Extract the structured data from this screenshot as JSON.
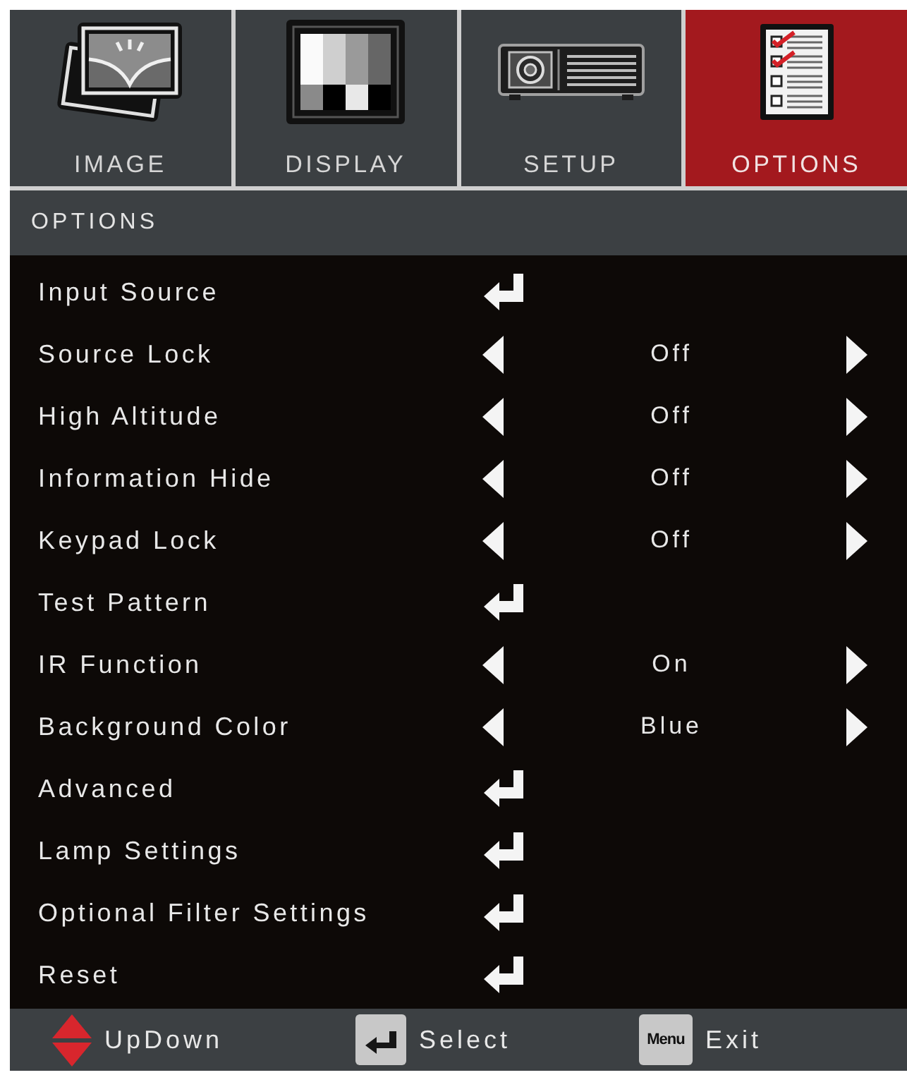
{
  "tabs": [
    {
      "label": "IMAGE",
      "kind": "image",
      "selected": false
    },
    {
      "label": "DISPLAY",
      "kind": "display",
      "selected": false
    },
    {
      "label": "SETUP",
      "kind": "setup",
      "selected": false
    },
    {
      "label": "OPTIONS",
      "kind": "options",
      "selected": true
    }
  ],
  "section_title": "OPTIONS",
  "items": [
    {
      "label": "Input Source",
      "kind": "submenu"
    },
    {
      "label": "Source Lock",
      "kind": "choice",
      "value": "Off"
    },
    {
      "label": "High Altitude",
      "kind": "choice",
      "value": "Off"
    },
    {
      "label": "Information Hide",
      "kind": "choice",
      "value": "Off"
    },
    {
      "label": "Keypad Lock",
      "kind": "choice",
      "value": "Off"
    },
    {
      "label": "Test Pattern",
      "kind": "submenu"
    },
    {
      "label": "IR Function",
      "kind": "choice",
      "value": "On"
    },
    {
      "label": "Background Color",
      "kind": "choice",
      "value": "Blue"
    },
    {
      "label": "Advanced",
      "kind": "submenu"
    },
    {
      "label": "Lamp Settings",
      "kind": "submenu"
    },
    {
      "label": "Optional Filter Settings",
      "kind": "submenu"
    },
    {
      "label": "Reset",
      "kind": "submenu"
    }
  ],
  "footer": [
    {
      "kind": "updown",
      "label": "UpDown"
    },
    {
      "kind": "enter",
      "label": "Select"
    },
    {
      "kind": "menu",
      "key": "Menu",
      "label": "Exit"
    }
  ]
}
